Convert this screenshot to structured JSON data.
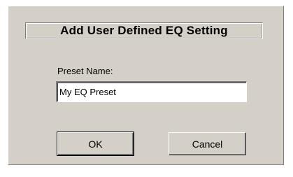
{
  "dialog": {
    "title": "Add User Defined EQ Setting",
    "preset_label": "Preset Name:",
    "preset_value": "My EQ Preset",
    "ok_label": "OK",
    "cancel_label": "Cancel"
  }
}
